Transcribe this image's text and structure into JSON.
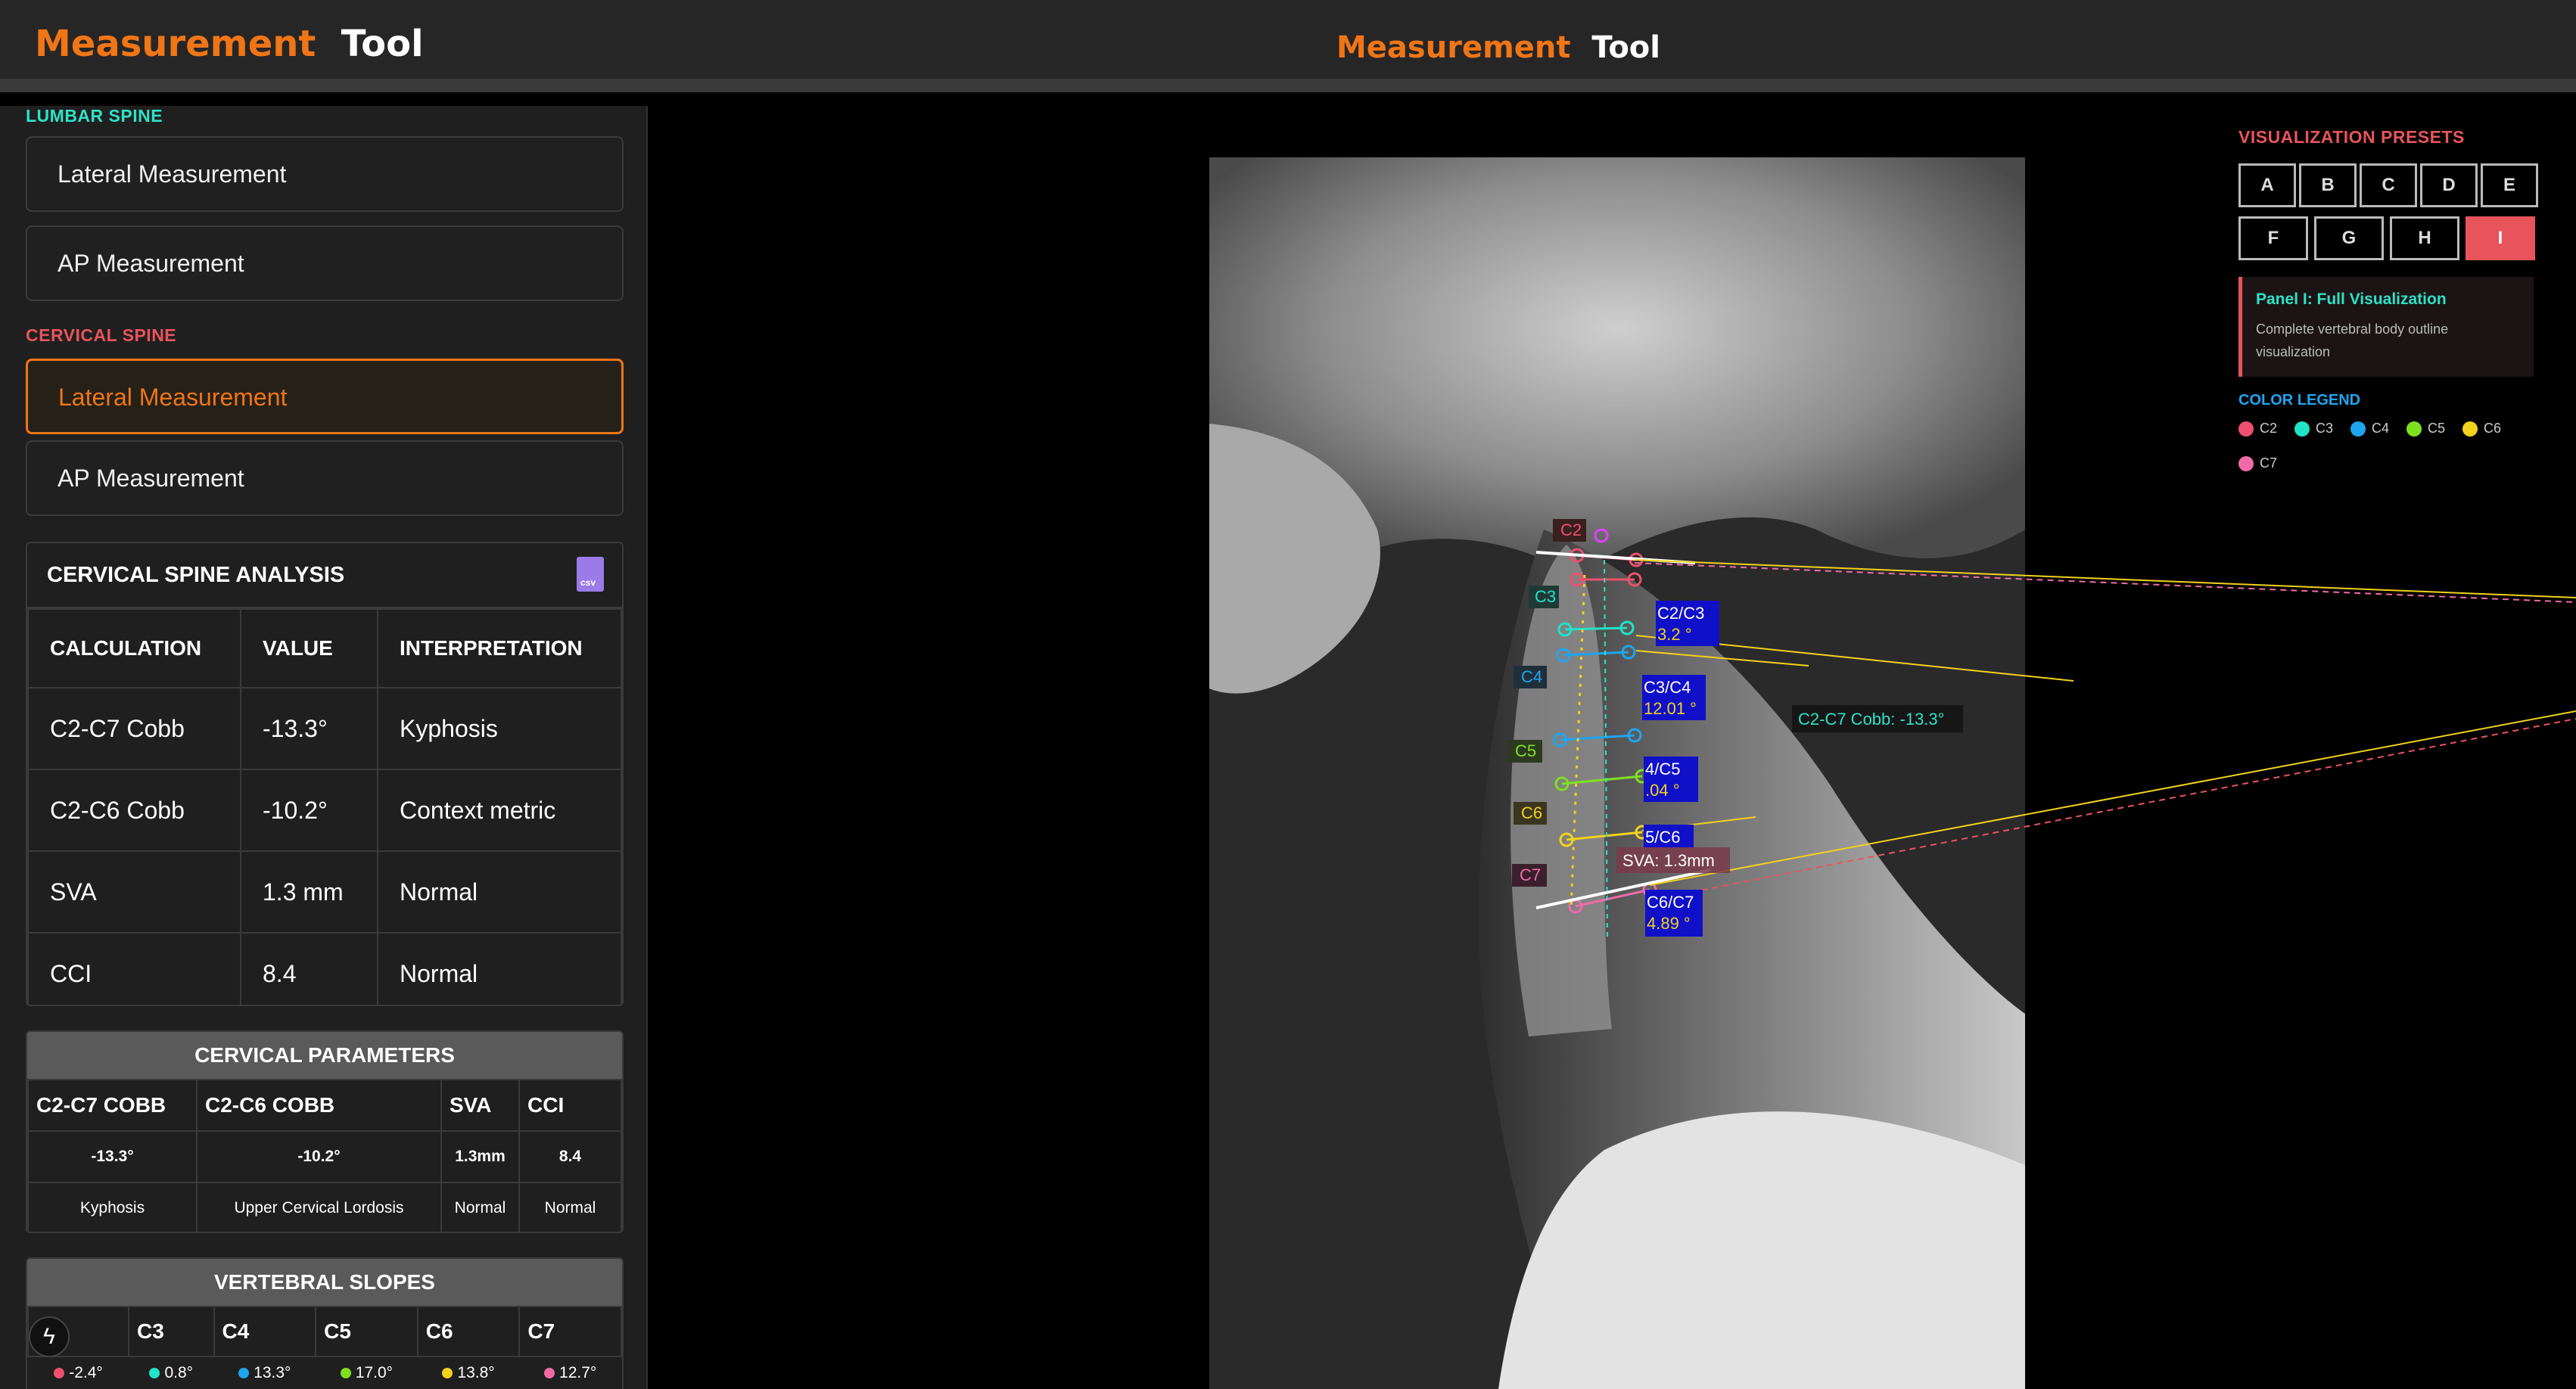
{
  "app": {
    "title_part1": "Measurement",
    "title_part2": "Tool"
  },
  "sidebar": {
    "lumbar_label": "LUMBAR SPINE",
    "lumbar_items": [
      "Lateral Measurement",
      "AP Measurement"
    ],
    "cervical_label": "CERVICAL SPINE",
    "cervical_items": [
      "Lateral Measurement",
      "AP Measurement"
    ],
    "active_item": "cervical-lateral"
  },
  "analysis": {
    "title": "CERVICAL SPINE ANALYSIS",
    "headers": [
      "CALCULATION",
      "VALUE",
      "INTERPRETATION"
    ],
    "rows": [
      [
        "C2-C7 Cobb",
        "-13.3°",
        "Kyphosis"
      ],
      [
        "C2-C6 Cobb",
        "-10.2°",
        "Context metric"
      ],
      [
        "SVA",
        "1.3 mm",
        "Normal"
      ],
      [
        "CCI",
        "8.4",
        "Normal"
      ]
    ]
  },
  "parameters": {
    "title": "CERVICAL PARAMETERS",
    "headers": [
      "C2-C7 COBB",
      "C2-C6 COBB",
      "SVA",
      "CCI"
    ],
    "values": [
      "-13.3°",
      "-10.2°",
      "1.3mm",
      "8.4"
    ],
    "interpretations": [
      "Kyphosis",
      "Upper Cervical Lordosis",
      "Normal",
      "Normal"
    ]
  },
  "slopes": {
    "title": "VERTEBRAL SLOPES",
    "headers": [
      "",
      "C3",
      "C4",
      "C5",
      "C6",
      "C7"
    ],
    "values": [
      "-2.4°",
      "0.8°",
      "13.3°",
      "17.0°",
      "13.8°",
      "12.7°"
    ]
  },
  "presets": {
    "title": "VISUALIZATION PRESETS",
    "items": [
      "A",
      "B",
      "C",
      "D",
      "E",
      "F",
      "G",
      "H",
      "I"
    ],
    "active": "I",
    "panel_title": "Panel I: Full Visualization",
    "panel_desc": "Complete vertebral body outline visualization"
  },
  "legend": {
    "title": "COLOR LEGEND",
    "items": [
      {
        "label": "C2",
        "color": "#f0506e"
      },
      {
        "label": "C3",
        "color": "#20e3c8"
      },
      {
        "label": "C4",
        "color": "#1fa5f0"
      },
      {
        "label": "C5",
        "color": "#7fe020"
      },
      {
        "label": "C6",
        "color": "#f2d21c"
      },
      {
        "label": "C7",
        "color": "#f06aa8"
      }
    ]
  },
  "overlay": {
    "vertebra_labels": [
      "C2",
      "C3",
      "C4",
      "C5",
      "C6",
      "C7"
    ],
    "angle_labels": [
      {
        "top": "C2/C3",
        "bottom": "3.2 °"
      },
      {
        "top": "C3/C4",
        "bottom": "12.01 °"
      },
      {
        "top": "4/C5",
        "bottom": ".04 °"
      },
      {
        "top": "5/C6",
        "bottom": ""
      },
      {
        "top": "C6/C7",
        "bottom": "4.89 °"
      }
    ],
    "cobb_label": "C2-C7 Cobb: -13.3°",
    "sva_label": "SVA: 1.3mm"
  },
  "colors": {
    "accent": "#f07516",
    "preset_active": "#e8545c",
    "teal": "#2de2c7"
  }
}
